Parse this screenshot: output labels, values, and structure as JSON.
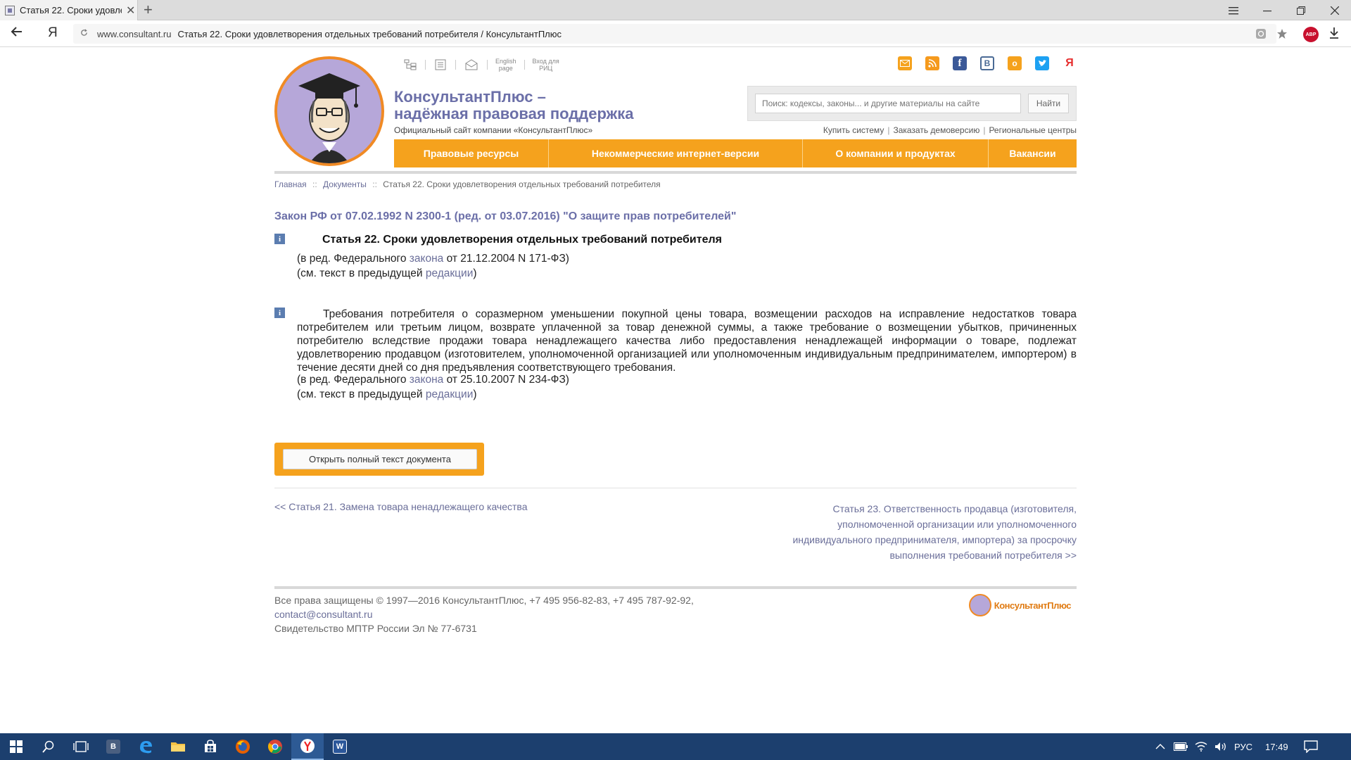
{
  "browser": {
    "tab_title": "Статья 22. Сроки удовле",
    "tab_close": "✕",
    "new_tab": "+",
    "nav_ya": "Я",
    "address_domain": "www.consultant.ru",
    "address_title": "Статья 22. Сроки удовлетворения отдельных требований потребителя / КонсультантПлюс",
    "abp_badge": "ABP"
  },
  "header": {
    "brand_line1": "КонсультантПлюс –",
    "brand_line2": "надёжная правовая поддержка",
    "brand_sub": "Официальный сайт компании «КонсультантПлюс»",
    "english_line1": "English",
    "english_line2": "page",
    "rits_line1": "Вход для",
    "rits_line2": "РИЦ",
    "search_placeholder": "Поиск: кодексы, законы... и другие материалы на сайте",
    "search_button": "Найти",
    "links": [
      "Купить систему",
      "Заказать демоверсию",
      "Региональные центры"
    ],
    "link_sep": "|",
    "social": {
      "vk": "В",
      "fb": "f",
      "ok": "о",
      "ya": "Я"
    }
  },
  "nav": {
    "items": [
      "Правовые ресурсы",
      "Некоммерческие интернет-версии",
      "О компании и продуктах",
      "Вакансии"
    ]
  },
  "breadcrumb": {
    "home": "Главная",
    "docs": "Документы",
    "current": "Статья 22. Сроки удовлетворения отдельных требований потребителя",
    "sep": "::"
  },
  "document": {
    "title": "Закон РФ от 07.02.1992 N 2300-1 (ред. от 03.07.2016) \"О защите прав потребителей\"",
    "info_icon": "i",
    "article_heading": "Статья 22. Сроки удовлетворения отдельных требований потребителя",
    "red1_prefix": "(в ред. Федерального ",
    "red1_link": "закона",
    "red1_suffix": " от 21.12.2004 N 171-ФЗ)",
    "prev1_prefix": "(см. текст в предыдущей ",
    "prev1_link": "редакции",
    "prev1_suffix": ")",
    "paragraph": "Требования потребителя о соразмерном уменьшении покупной цены товара, возмещении расходов на исправление недостатков товара потребителем или третьим лицом, возврате уплаченной за товар денежной суммы, а также требование о возмещении убытков, причиненных потребителю вследствие продажи товара ненадлежащего качества либо предоставления ненадлежащей информации о товаре, подлежат удовлетворению продавцом (изготовителем, уполномоченной организацией или уполномоченным индивидуальным предпринимателем, импортером) в течение десяти дней со дня предъявления соответствующего требования.",
    "red2_prefix": "(в ред. Федерального ",
    "red2_link": "закона",
    "red2_suffix": " от 25.10.2007 N 234-ФЗ)",
    "prev2_prefix": "(см. текст в предыдущей ",
    "prev2_link": "редакции",
    "prev2_suffix": ")",
    "open_full_button": "Открыть полный текст документа",
    "prev_article": "<< Статья 21. Замена товара ненадлежащего качества",
    "next_article_lines": [
      "Статья 23. Ответственность продавца (изготовителя,",
      "уполномоченной организации или уполномоченного",
      "индивидуального предпринимателя, импортера) за просрочку",
      "выполнения требований потребителя >>"
    ]
  },
  "footer": {
    "copyright": "Все права защищены © 1997—2016 КонсультантПлюс, +7 495 956-82-83, +7 495 787-92-92,",
    "email": "contact@consultant.ru",
    "certificate": "Свидетельство МПТР России Эл № 77-6731",
    "logo_text": "КонсультантПлюс"
  },
  "taskbar": {
    "pinned_b": "B",
    "pinned_w": "W",
    "lang": "РУС",
    "time": "17:49"
  },
  "colors": {
    "accent_orange": "#f5a21d",
    "brand_purple": "#6b6fa8",
    "link": "#6a6e99",
    "taskbar": "#1c3f6e"
  }
}
